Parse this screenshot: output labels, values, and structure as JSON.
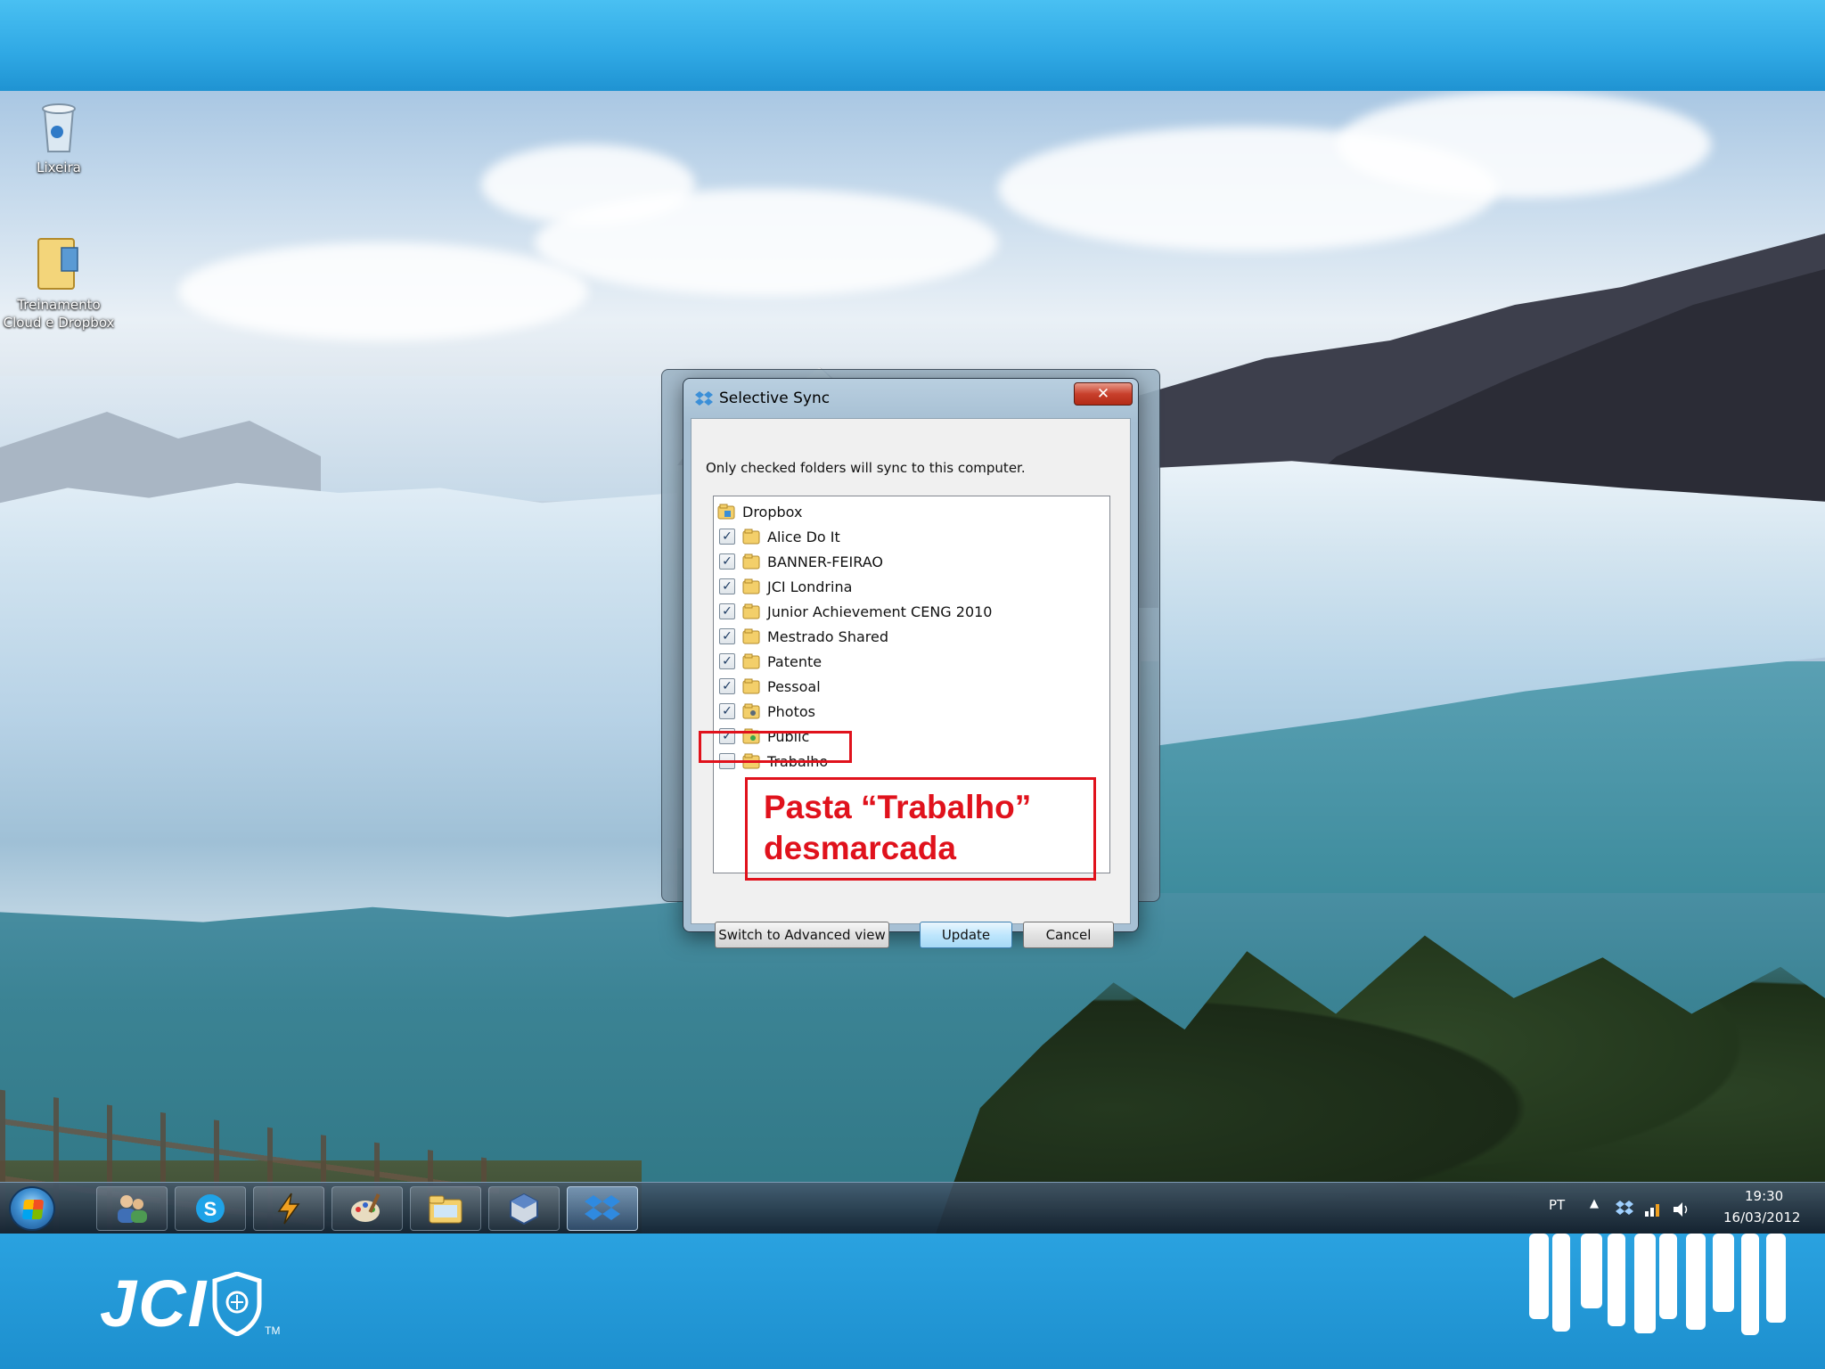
{
  "desktop": {
    "icons": [
      {
        "label": "Lixeira",
        "icon": "recycle-bin-icon"
      },
      {
        "label": "Treinamento Cloud e Dropbox",
        "icon": "folder-icon"
      }
    ]
  },
  "dialog": {
    "title": "Selective Sync",
    "close_label": "✕",
    "instruction": "Only checked folders will sync to this computer.",
    "root": "Dropbox",
    "folders": [
      {
        "name": "Alice Do It",
        "checked": true
      },
      {
        "name": "BANNER-FEIRAO",
        "checked": true
      },
      {
        "name": "JCI Londrina",
        "checked": true
      },
      {
        "name": "Junior Achievement CENG 2010",
        "checked": true
      },
      {
        "name": "Mestrado Shared",
        "checked": true
      },
      {
        "name": "Patente",
        "checked": true
      },
      {
        "name": "Pessoal",
        "checked": true
      },
      {
        "name": "Photos",
        "checked": true
      },
      {
        "name": "Public",
        "checked": true
      },
      {
        "name": "Trabalho",
        "checked": false
      }
    ],
    "buttons": {
      "advanced": "Switch to Advanced view",
      "update": "Update",
      "cancel": "Cancel"
    }
  },
  "annotation": {
    "line1": "Pasta “Trabalho”",
    "line2": "desmarcada"
  },
  "taskbar": {
    "apps": [
      "users-icon",
      "skype-icon",
      "winamp-icon",
      "paint-icon",
      "explorer-icon",
      "virtualbox-icon",
      "dropbox-icon"
    ],
    "language": "PT",
    "time": "19:30",
    "date": "16/03/2012"
  },
  "branding": {
    "logo": "JCI",
    "tm": "TM"
  },
  "colors": {
    "annotation": "#e0121c",
    "slide_bar": "#2aa2e0"
  }
}
